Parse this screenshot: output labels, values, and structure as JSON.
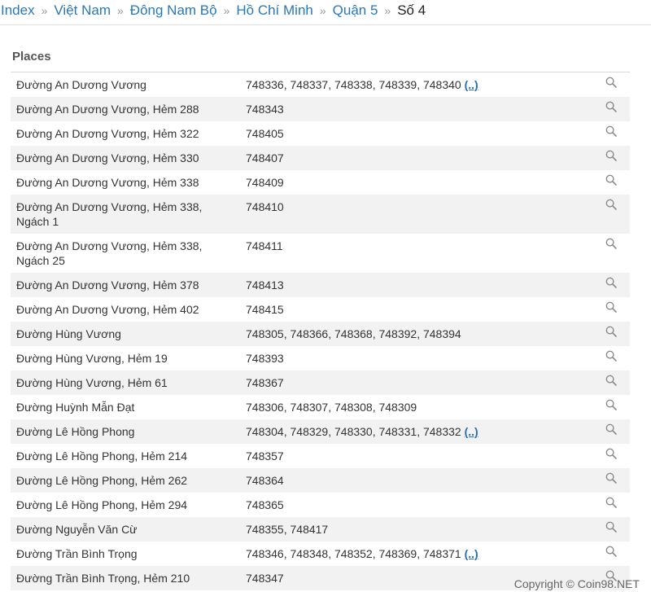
{
  "breadcrumb": [
    {
      "label": "Index",
      "link": true
    },
    {
      "label": "Việt Nam",
      "link": true
    },
    {
      "label": "Đông Nam Bộ",
      "link": true
    },
    {
      "label": "Hồ Chí Minh",
      "link": true
    },
    {
      "label": "Quận 5",
      "link": true
    },
    {
      "label": "Số 4",
      "link": false
    }
  ],
  "separator": "»",
  "section_title": "Places",
  "more_label": "(..)",
  "rows": [
    {
      "name": "Đường An Dương Vương",
      "codes": "748336, 748337, 748338, 748339, 748340",
      "more": true
    },
    {
      "name": "Đường An Dương Vương, Hẻm 288",
      "codes": "748343",
      "more": false
    },
    {
      "name": "Đường An Dương Vương, Hẻm 322",
      "codes": "748405",
      "more": false
    },
    {
      "name": "Đường An Dương Vương, Hẻm 330",
      "codes": "748407",
      "more": false
    },
    {
      "name": "Đường An Dương Vương, Hẻm 338",
      "codes": "748409",
      "more": false
    },
    {
      "name": "Đường An Dương Vương, Hẻm 338, Ngách 1",
      "codes": "748410",
      "more": false
    },
    {
      "name": "Đường An Dương Vương, Hẻm 338, Ngách 25",
      "codes": "748411",
      "more": false
    },
    {
      "name": "Đường An Dương Vương, Hẻm 378",
      "codes": "748413",
      "more": false
    },
    {
      "name": "Đường An Dương Vương, Hẻm 402",
      "codes": "748415",
      "more": false
    },
    {
      "name": "Đường Hùng Vương",
      "codes": "748305, 748366, 748368, 748392, 748394",
      "more": false
    },
    {
      "name": "Đường Hùng Vương, Hẻm 19",
      "codes": "748393",
      "more": false
    },
    {
      "name": "Đường Hùng Vương, Hẻm 61",
      "codes": "748367",
      "more": false
    },
    {
      "name": "Đường Huỳnh Mẫn Đạt",
      "codes": "748306, 748307, 748308, 748309",
      "more": false
    },
    {
      "name": "Đường Lê Hồng Phong",
      "codes": "748304, 748329, 748330, 748331, 748332",
      "more": true
    },
    {
      "name": "Đường Lê Hồng Phong, Hẻm 214",
      "codes": "748357",
      "more": false
    },
    {
      "name": "Đường Lê Hồng Phong, Hẻm 262",
      "codes": "748364",
      "more": false
    },
    {
      "name": "Đường Lê Hồng Phong, Hẻm 294",
      "codes": "748365",
      "more": false
    },
    {
      "name": "Đường Nguyễn Văn Cừ",
      "codes": "748355, 748417",
      "more": false
    },
    {
      "name": "Đường Trần Bình Trọng",
      "codes": "748346, 748348, 748352, 748369, 748371",
      "more": true
    },
    {
      "name": "Đường Trần Bình Trọng, Hẻm 210",
      "codes": "748347",
      "more": false
    }
  ],
  "footer": "Copyright © Coin98.NET",
  "icons": {
    "search": "magnifier-icon"
  },
  "colors": {
    "link": "#2a78b4",
    "row_alt": "#f2f2f2"
  }
}
